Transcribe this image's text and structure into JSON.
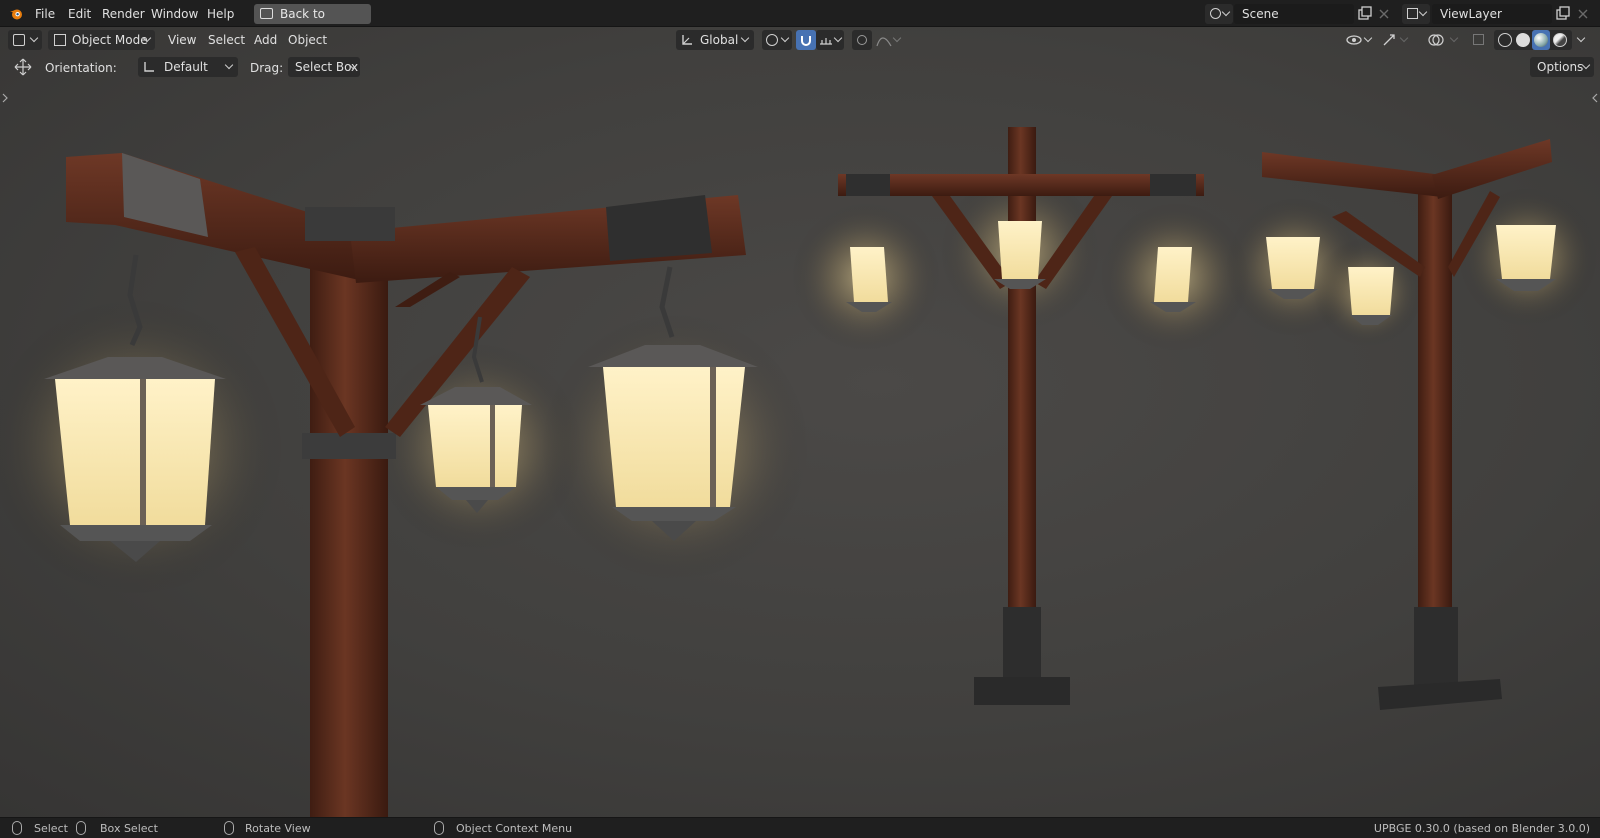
{
  "app": {
    "menu": [
      "File",
      "Edit",
      "Render",
      "Window",
      "Help"
    ],
    "back_button": "Back to Previous",
    "scene": "Scene",
    "view_layer": "ViewLayer"
  },
  "header": {
    "mode": "Object Mode",
    "menus": [
      "View",
      "Select",
      "Add",
      "Object"
    ],
    "transform_orientation": "Global"
  },
  "tool_settings": {
    "orientation_label": "Orientation:",
    "orientation_value": "Default",
    "drag_label": "Drag:",
    "drag_value": "Select Box",
    "options": "Options"
  },
  "statusbar": {
    "select": "Select",
    "box_select": "Box Select",
    "rotate_view": "Rotate View",
    "context_menu": "Object Context Menu",
    "version": "UPBGE 0.30.0 (based on Blender 3.0.0)"
  },
  "colors": {
    "accent_blue": "#4772b3",
    "lantern_glow": "#f6e7b6",
    "wood": "#5b2e1e",
    "metal": "#3a3a3a"
  }
}
